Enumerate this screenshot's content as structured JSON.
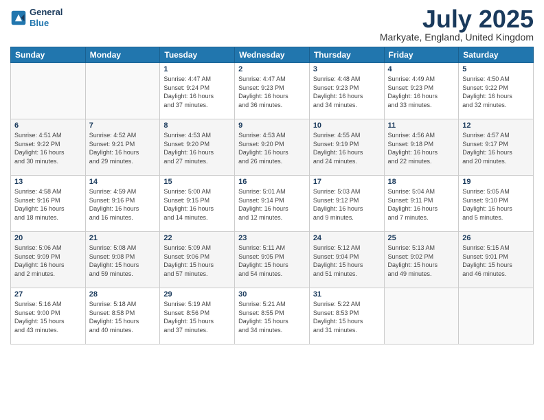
{
  "header": {
    "logo_line1": "General",
    "logo_line2": "Blue",
    "month_title": "July 2025",
    "location": "Markyate, England, United Kingdom"
  },
  "weekdays": [
    "Sunday",
    "Monday",
    "Tuesday",
    "Wednesday",
    "Thursday",
    "Friday",
    "Saturday"
  ],
  "weeks": [
    [
      {
        "day": "",
        "info": ""
      },
      {
        "day": "",
        "info": ""
      },
      {
        "day": "1",
        "info": "Sunrise: 4:47 AM\nSunset: 9:24 PM\nDaylight: 16 hours\nand 37 minutes."
      },
      {
        "day": "2",
        "info": "Sunrise: 4:47 AM\nSunset: 9:23 PM\nDaylight: 16 hours\nand 36 minutes."
      },
      {
        "day": "3",
        "info": "Sunrise: 4:48 AM\nSunset: 9:23 PM\nDaylight: 16 hours\nand 34 minutes."
      },
      {
        "day": "4",
        "info": "Sunrise: 4:49 AM\nSunset: 9:23 PM\nDaylight: 16 hours\nand 33 minutes."
      },
      {
        "day": "5",
        "info": "Sunrise: 4:50 AM\nSunset: 9:22 PM\nDaylight: 16 hours\nand 32 minutes."
      }
    ],
    [
      {
        "day": "6",
        "info": "Sunrise: 4:51 AM\nSunset: 9:22 PM\nDaylight: 16 hours\nand 30 minutes."
      },
      {
        "day": "7",
        "info": "Sunrise: 4:52 AM\nSunset: 9:21 PM\nDaylight: 16 hours\nand 29 minutes."
      },
      {
        "day": "8",
        "info": "Sunrise: 4:53 AM\nSunset: 9:20 PM\nDaylight: 16 hours\nand 27 minutes."
      },
      {
        "day": "9",
        "info": "Sunrise: 4:53 AM\nSunset: 9:20 PM\nDaylight: 16 hours\nand 26 minutes."
      },
      {
        "day": "10",
        "info": "Sunrise: 4:55 AM\nSunset: 9:19 PM\nDaylight: 16 hours\nand 24 minutes."
      },
      {
        "day": "11",
        "info": "Sunrise: 4:56 AM\nSunset: 9:18 PM\nDaylight: 16 hours\nand 22 minutes."
      },
      {
        "day": "12",
        "info": "Sunrise: 4:57 AM\nSunset: 9:17 PM\nDaylight: 16 hours\nand 20 minutes."
      }
    ],
    [
      {
        "day": "13",
        "info": "Sunrise: 4:58 AM\nSunset: 9:16 PM\nDaylight: 16 hours\nand 18 minutes."
      },
      {
        "day": "14",
        "info": "Sunrise: 4:59 AM\nSunset: 9:16 PM\nDaylight: 16 hours\nand 16 minutes."
      },
      {
        "day": "15",
        "info": "Sunrise: 5:00 AM\nSunset: 9:15 PM\nDaylight: 16 hours\nand 14 minutes."
      },
      {
        "day": "16",
        "info": "Sunrise: 5:01 AM\nSunset: 9:14 PM\nDaylight: 16 hours\nand 12 minutes."
      },
      {
        "day": "17",
        "info": "Sunrise: 5:03 AM\nSunset: 9:12 PM\nDaylight: 16 hours\nand 9 minutes."
      },
      {
        "day": "18",
        "info": "Sunrise: 5:04 AM\nSunset: 9:11 PM\nDaylight: 16 hours\nand 7 minutes."
      },
      {
        "day": "19",
        "info": "Sunrise: 5:05 AM\nSunset: 9:10 PM\nDaylight: 16 hours\nand 5 minutes."
      }
    ],
    [
      {
        "day": "20",
        "info": "Sunrise: 5:06 AM\nSunset: 9:09 PM\nDaylight: 16 hours\nand 2 minutes."
      },
      {
        "day": "21",
        "info": "Sunrise: 5:08 AM\nSunset: 9:08 PM\nDaylight: 15 hours\nand 59 minutes."
      },
      {
        "day": "22",
        "info": "Sunrise: 5:09 AM\nSunset: 9:06 PM\nDaylight: 15 hours\nand 57 minutes."
      },
      {
        "day": "23",
        "info": "Sunrise: 5:11 AM\nSunset: 9:05 PM\nDaylight: 15 hours\nand 54 minutes."
      },
      {
        "day": "24",
        "info": "Sunrise: 5:12 AM\nSunset: 9:04 PM\nDaylight: 15 hours\nand 51 minutes."
      },
      {
        "day": "25",
        "info": "Sunrise: 5:13 AM\nSunset: 9:02 PM\nDaylight: 15 hours\nand 49 minutes."
      },
      {
        "day": "26",
        "info": "Sunrise: 5:15 AM\nSunset: 9:01 PM\nDaylight: 15 hours\nand 46 minutes."
      }
    ],
    [
      {
        "day": "27",
        "info": "Sunrise: 5:16 AM\nSunset: 9:00 PM\nDaylight: 15 hours\nand 43 minutes."
      },
      {
        "day": "28",
        "info": "Sunrise: 5:18 AM\nSunset: 8:58 PM\nDaylight: 15 hours\nand 40 minutes."
      },
      {
        "day": "29",
        "info": "Sunrise: 5:19 AM\nSunset: 8:56 PM\nDaylight: 15 hours\nand 37 minutes."
      },
      {
        "day": "30",
        "info": "Sunrise: 5:21 AM\nSunset: 8:55 PM\nDaylight: 15 hours\nand 34 minutes."
      },
      {
        "day": "31",
        "info": "Sunrise: 5:22 AM\nSunset: 8:53 PM\nDaylight: 15 hours\nand 31 minutes."
      },
      {
        "day": "",
        "info": ""
      },
      {
        "day": "",
        "info": ""
      }
    ]
  ]
}
